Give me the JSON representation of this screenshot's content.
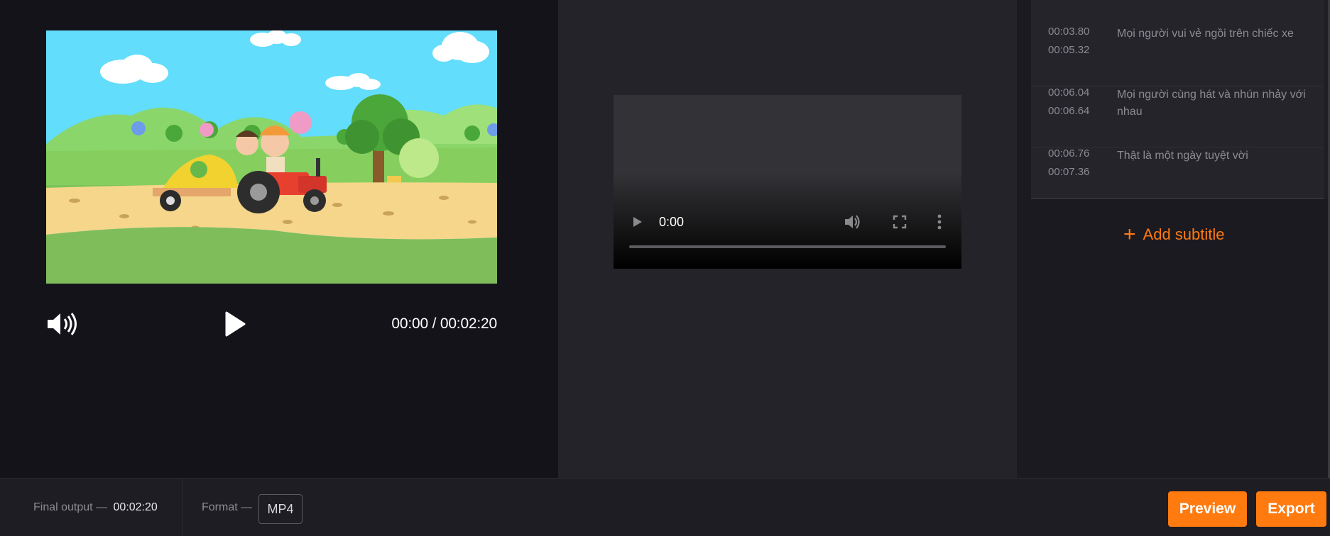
{
  "editor": {
    "current_time": "00:00",
    "separator": "/",
    "duration": "00:02:20",
    "time_display": "00:00 / 00:02:20"
  },
  "preview_player": {
    "time": "0:00"
  },
  "subtitles": [
    {
      "start": "00:03.80",
      "end": "00:05.32",
      "text": "Mọi người vui vẻ ngồi trên chiếc xe"
    },
    {
      "start": "00:06.04",
      "end": "00:06.64",
      "text": "Mọi người cùng hát và nhún nhảy với nhau"
    },
    {
      "start": "00:06.76",
      "end": "00:07.36",
      "text": "Thật là một ngày tuyệt vời"
    }
  ],
  "add_subtitle": {
    "label": "Add subtitle"
  },
  "footer": {
    "final_output_label": "Final output",
    "dash": "—",
    "final_output_value": "00:02:20",
    "format_label": "Format",
    "format_value": "MP4",
    "preview_label": "Preview",
    "export_label": "Export"
  },
  "colors": {
    "accent": "#ff7a0f",
    "panel_dark": "#14131a",
    "panel_mid": "#24232a"
  },
  "icons": {
    "volume": "volume-icon",
    "play": "play-icon",
    "fullscreen": "fullscreen-icon",
    "more": "more-vertical-icon",
    "add": "plus-icon"
  }
}
